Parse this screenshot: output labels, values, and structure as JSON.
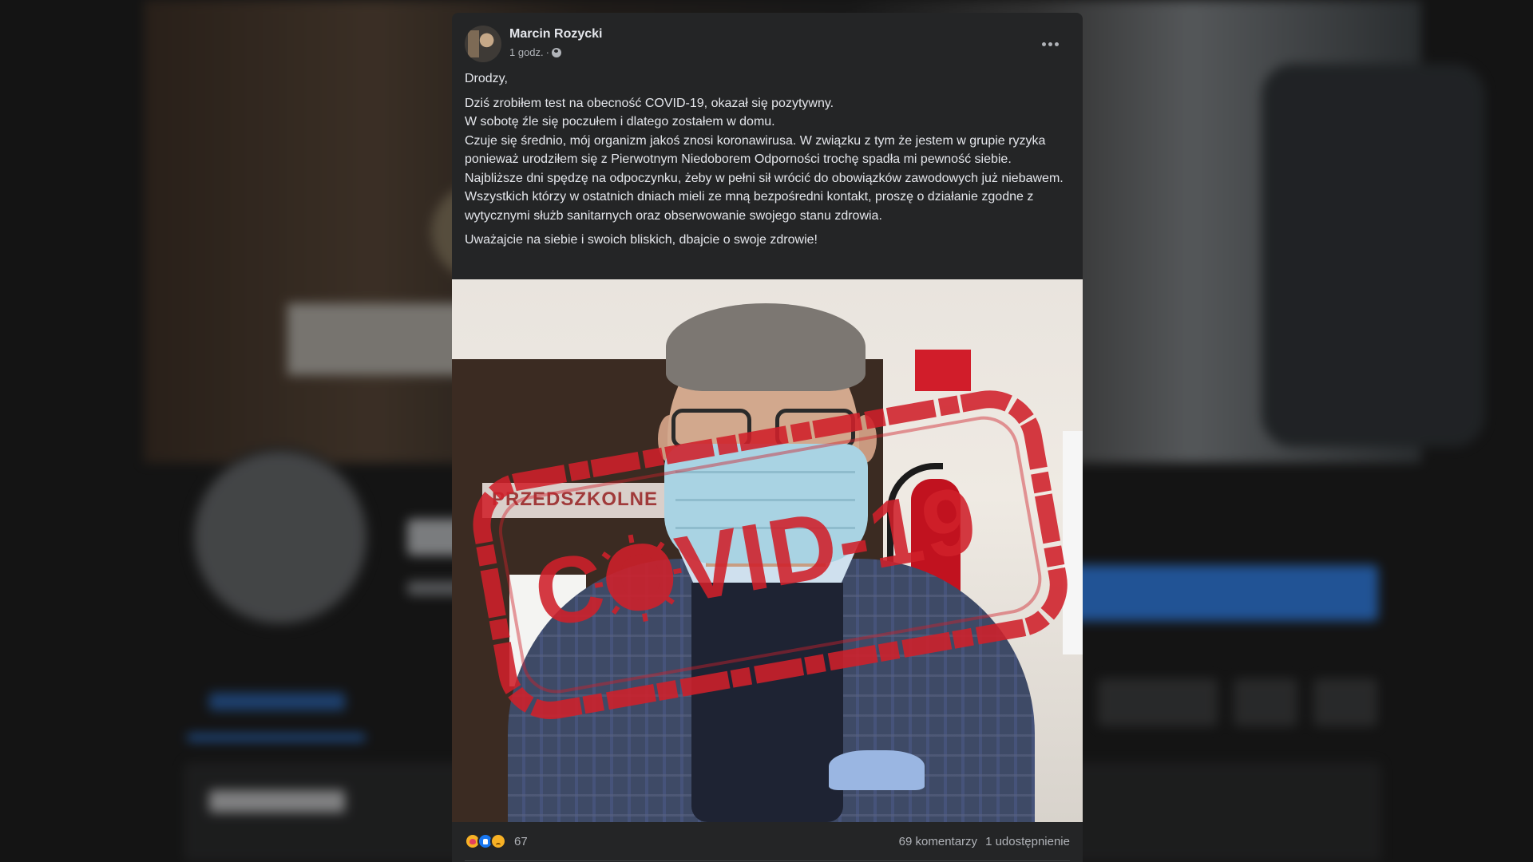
{
  "post": {
    "author": "Marcin Rozycki",
    "time": "1 godz.",
    "separator": "·",
    "audience_icon": "globe-icon",
    "more_icon": "more-options-icon",
    "paragraphs": [
      "Drodzy,",
      "Dziś zrobiłem test na obecność COVID-19, okazał się pozytywny.\nW sobotę źle się poczułem i dlatego zostałem w domu.\nCzuje się średnio, mój organizm jakoś znosi koronawirusa. W związku z tym że jestem w grupie ryzyka ponieważ urodziłem się z Pierwotnym Niedoborem Odporności trochę spadła mi pewność siebie. Najbliższe dni spędzę na odpoczynku, żeby w pełni sił wrócić do obowiązków zawodowych już niebawem.\nWszystkich którzy w ostatnich dniach mieli ze mną bezpośredni kontakt, proszę o działanie zgodne z wytycznymi służb sanitarnych oraz obserwowanie swojego stanu zdrowia.",
      "Uważajcie na siebie i swoich bliskich, dbajcie o swoje zdrowie!"
    ]
  },
  "photo": {
    "banner_text": "PRZEDSZKOLNE",
    "stamp_text": "COVID-19",
    "stamp_color": "#d0202a"
  },
  "footer": {
    "reactions": [
      "love-reaction-icon",
      "like-reaction-icon",
      "sad-reaction-icon"
    ],
    "reaction_count": "67",
    "comments": "69 komentarzy",
    "shares": "1 udostępnienie"
  },
  "colors": {
    "card_bg": "#242526",
    "text_primary": "#e4e6eb",
    "text_secondary": "#b0b3b8",
    "accent_blue": "#2d88ff"
  }
}
